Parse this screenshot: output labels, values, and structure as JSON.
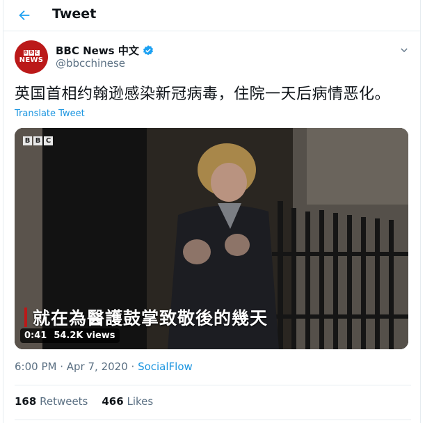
{
  "header": {
    "title": "Tweet",
    "back_icon": "arrow-left-icon"
  },
  "colors": {
    "accent": "#1da1f2",
    "link": "#1b95e0",
    "bbc_red": "#bb1919"
  },
  "author": {
    "name": "BBC News 中文",
    "handle": "@bbcchinese",
    "verified": true,
    "avatar": {
      "letters": [
        "B",
        "B",
        "C"
      ],
      "word": "NEWS"
    }
  },
  "tweet": {
    "text": "英国首相约翰逊感染新冠病毒，住院一天后病情恶化。",
    "translate_label": "Translate Tweet"
  },
  "media": {
    "watermark": [
      "B",
      "B",
      "C"
    ],
    "subtitle": "就在為醫護鼓掌致敬後的幾天",
    "duration": "0:41",
    "views": "54.2K views"
  },
  "meta": {
    "time": "6:00 PM",
    "sep1": " · ",
    "date": "Apr 7, 2020",
    "sep2": " · ",
    "source": "SocialFlow"
  },
  "stats": {
    "retweets_count": "168",
    "retweets_label": "Retweets",
    "likes_count": "466",
    "likes_label": "Likes"
  }
}
